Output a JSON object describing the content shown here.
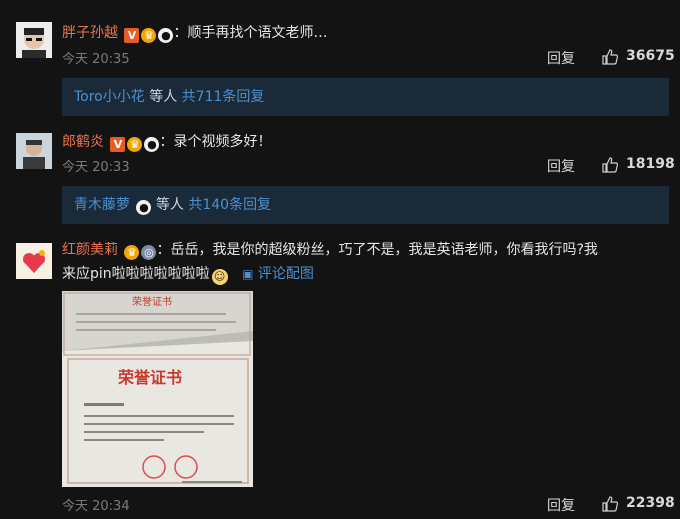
{
  "comments": [
    {
      "username": "胖子孙越",
      "text": "：顺手再找个语文老师…",
      "time": "今天 20:35",
      "reply_label": "回复",
      "likes": "36675",
      "replies": {
        "user": "Toro小小花",
        "suffix": " 等人 ",
        "count": "共711条回复"
      }
    },
    {
      "username": "郎鹤炎",
      "text": "：录个视频多好！",
      "time": "今天 20:33",
      "reply_label": "回复",
      "likes": "18198",
      "replies": {
        "user": "青木藤萝",
        "suffix": " 等人 ",
        "count": "共140条回复"
      }
    },
    {
      "username": "红颜美莉",
      "text_line1": "：岳岳，我是你的超级粉丝，巧了不是，我是英语老师，你看我行吗?我",
      "text_line2": "来应pin啦啦啦啦啦啦啦",
      "pic_link": "评论配图",
      "image_texts": {
        "cert_title_small": "荣誉证书",
        "cert_title_large": "荣誉证书"
      },
      "time": "今天 20:34",
      "reply_label": "回复",
      "likes": "22398"
    }
  ],
  "icons": [
    "vip-v-icon",
    "crown-badge-icon",
    "panda-badge-icon",
    "medal-badge-icon",
    "thumbs-up-icon",
    "picture-icon",
    "shy-emoji-icon"
  ],
  "colors": {
    "background": "#131313",
    "username": "#eb7350",
    "link": "#4a90d4",
    "reply_box": "#1a2a38",
    "meta": "#7b7b7b"
  }
}
